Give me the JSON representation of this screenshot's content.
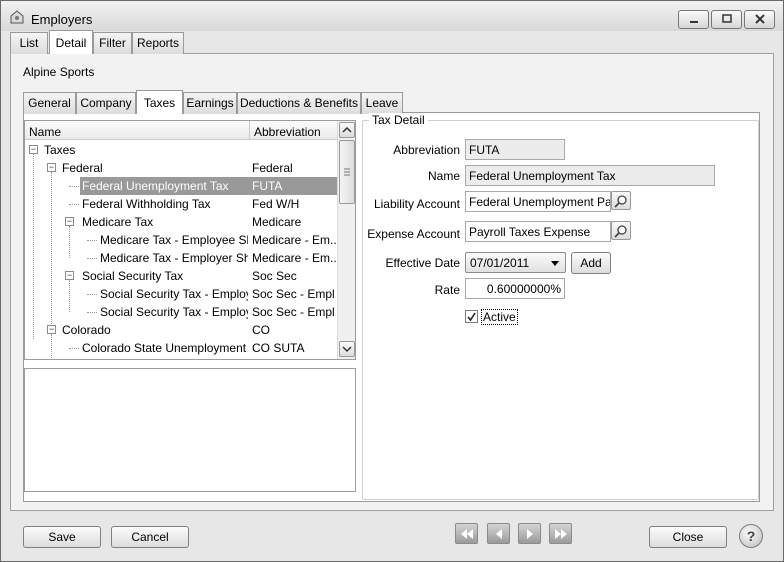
{
  "window": {
    "title": "Employers",
    "minimize_icon": "minimize-icon",
    "maximize_icon": "maximize-icon",
    "close_icon": "close-icon"
  },
  "top_tabs": [
    {
      "label": "List"
    },
    {
      "label": "Detail",
      "active": true
    },
    {
      "label": "Filter"
    },
    {
      "label": "Reports"
    }
  ],
  "company_name": "Alpine Sports",
  "inner_tabs": [
    {
      "label": "General"
    },
    {
      "label": "Company"
    },
    {
      "label": "Taxes",
      "active": true
    },
    {
      "label": "Earnings"
    },
    {
      "label": "Deductions & Benefits"
    },
    {
      "label": "Leave"
    }
  ],
  "tree": {
    "columns": {
      "name": "Name",
      "abbreviation": "Abbreviation"
    },
    "rows": [
      {
        "name": "Taxes",
        "abbr": "",
        "level": 0,
        "expandable": true
      },
      {
        "name": "Federal",
        "abbr": "Federal",
        "level": 1,
        "expandable": true
      },
      {
        "name": "Federal Unemployment Tax",
        "abbr": "FUTA",
        "level": 2,
        "expandable": false,
        "selected": true
      },
      {
        "name": "Federal Withholding Tax",
        "abbr": "Fed W/H",
        "level": 2,
        "expandable": false
      },
      {
        "name": "Medicare Tax",
        "abbr": "Medicare",
        "level": 2,
        "expandable": true
      },
      {
        "name": "Medicare Tax - Employee Sh...",
        "abbr": "Medicare - Em...",
        "level": 3,
        "expandable": false
      },
      {
        "name": "Medicare Tax - Employer Sh...",
        "abbr": "Medicare - Em...",
        "level": 3,
        "expandable": false
      },
      {
        "name": "Social Security Tax",
        "abbr": "Soc Sec",
        "level": 2,
        "expandable": true
      },
      {
        "name": "Social Security Tax - Employ...",
        "abbr": "Soc Sec - Empl...",
        "level": 3,
        "expandable": false
      },
      {
        "name": "Social Security Tax - Employ...",
        "abbr": "Soc Sec - Empl...",
        "level": 3,
        "expandable": false
      },
      {
        "name": "Colorado",
        "abbr": "CO",
        "level": 1,
        "expandable": true
      },
      {
        "name": "Colorado State Unemployment ...",
        "abbr": "CO SUTA",
        "level": 2,
        "expandable": false
      }
    ]
  },
  "tax_detail": {
    "title": "Tax Detail",
    "abbreviation_label": "Abbreviation",
    "abbreviation_value": "FUTA",
    "name_label": "Name",
    "name_value": "Federal Unemployment Tax",
    "liability_label": "Liability Account",
    "liability_value": "Federal Unemployment Payable",
    "expense_label": "Expense Account",
    "expense_value": "Payroll Taxes Expense",
    "effective_date_label": "Effective Date",
    "effective_date_value": "07/01/2011",
    "add_label": "Add",
    "rate_label": "Rate",
    "rate_value": "0.60000000%",
    "active_label": "Active",
    "active_checked": true
  },
  "footer": {
    "save_label": "Save",
    "cancel_label": "Cancel",
    "close_label": "Close",
    "help_label": "?"
  }
}
